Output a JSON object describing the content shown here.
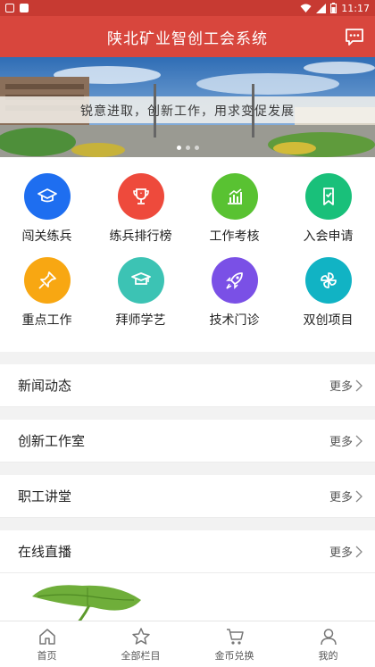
{
  "status_bar": {
    "time": "11:17"
  },
  "header": {
    "title": "陕北矿业智创工会系统",
    "message_icon": "message-icon"
  },
  "banner": {
    "slogan": "锐意进取，创新工作，用求变促发展"
  },
  "grid": [
    {
      "label": "闯关练兵",
      "color": "#1e6ef0",
      "icon": "graduation-cap-icon"
    },
    {
      "label": "练兵排行榜",
      "color": "#ee4a3c",
      "icon": "trophy-icon"
    },
    {
      "label": "工作考核",
      "color": "#59c232",
      "icon": "bar-chart-icon"
    },
    {
      "label": "入会申请",
      "color": "#19c07a",
      "icon": "bookmark-icon"
    },
    {
      "label": "重点工作",
      "color": "#f8a712",
      "icon": "pin-icon"
    },
    {
      "label": "拜师学艺",
      "color": "#3cc3b4",
      "icon": "mortarboard-icon"
    },
    {
      "label": "技术门诊",
      "color": "#7a50e6",
      "icon": "rocket-icon"
    },
    {
      "label": "双创项目",
      "color": "#11b3c4",
      "icon": "pinwheel-icon"
    }
  ],
  "sections": [
    {
      "title": "新闻动态",
      "more": "更多"
    },
    {
      "title": "创新工作室",
      "more": "更多"
    },
    {
      "title": "职工讲堂",
      "more": "更多"
    },
    {
      "title": "在线直播",
      "more": "更多"
    }
  ],
  "bottom_nav": [
    {
      "label": "首页",
      "icon": "home-icon"
    },
    {
      "label": "全部栏目",
      "icon": "star-icon"
    },
    {
      "label": "金币兑换",
      "icon": "cart-icon"
    },
    {
      "label": "我的",
      "icon": "user-icon"
    }
  ]
}
